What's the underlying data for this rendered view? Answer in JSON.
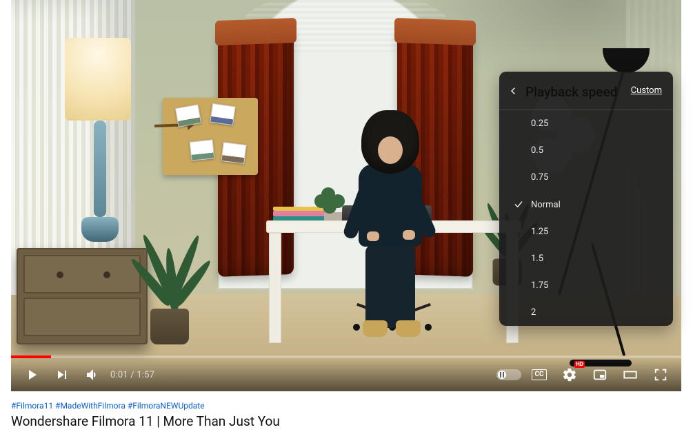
{
  "player": {
    "time_current": "0:01",
    "time_separator": " / ",
    "time_total": "1:57",
    "settings_badge": "HD",
    "cc_label": "CC"
  },
  "settings_menu": {
    "title": "Playback speed",
    "custom_label": "Custom",
    "selected_index": 3,
    "options": [
      {
        "label": "0.25"
      },
      {
        "label": "0.5"
      },
      {
        "label": "0.75"
      },
      {
        "label": "Normal"
      },
      {
        "label": "1.25"
      },
      {
        "label": "1.5"
      },
      {
        "label": "1.75"
      },
      {
        "label": "2"
      }
    ]
  },
  "video": {
    "hashtags": "#Filmora11 #MadeWithFilmora #FilmoraNEWUpdate",
    "title": "Wondershare Filmora 11 | More Than Just You"
  }
}
